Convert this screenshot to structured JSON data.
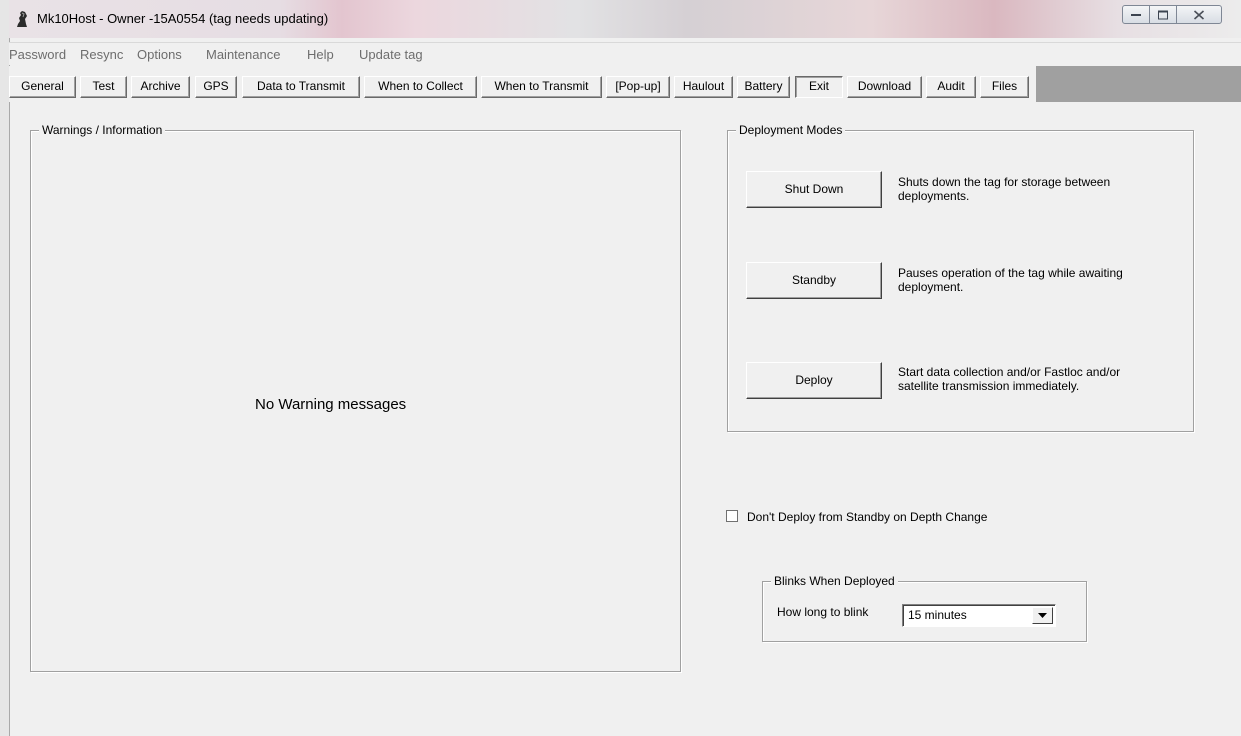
{
  "window": {
    "title": "Mk10Host - Owner -15A0554 (tag needs updating)"
  },
  "menu": [
    "Password",
    "Resync",
    "Options",
    "Maintenance",
    "Help",
    "Update tag"
  ],
  "tabs": [
    {
      "label": "General"
    },
    {
      "label": "Test"
    },
    {
      "label": "Archive"
    },
    {
      "label": "GPS"
    },
    {
      "label": "Data to Transmit"
    },
    {
      "label": "When to Collect"
    },
    {
      "label": "When to Transmit"
    },
    {
      "label": "[Pop-up]"
    },
    {
      "label": "Haulout"
    },
    {
      "label": "Battery"
    },
    {
      "label": "Exit",
      "active": true
    },
    {
      "label": "Download"
    },
    {
      "label": "Audit"
    },
    {
      "label": "Files"
    }
  ],
  "warnings": {
    "title": "Warnings / Information",
    "message": "No Warning messages"
  },
  "deployment": {
    "title": "Deployment Modes",
    "modes": [
      {
        "button": "Shut Down",
        "description": "Shuts down the tag for storage between deployments."
      },
      {
        "button": "Standby",
        "description": "Pauses operation of the tag while awaiting deployment."
      },
      {
        "button": "Deploy",
        "description": "Start data collection and/or Fastloc and/or satellite transmission immediately."
      }
    ]
  },
  "standby_option": {
    "label": "Don't Deploy from Standby on Depth Change",
    "checked": false
  },
  "blinks": {
    "title": "Blinks When Deployed",
    "label": "How long to blink",
    "value": "15 minutes"
  }
}
